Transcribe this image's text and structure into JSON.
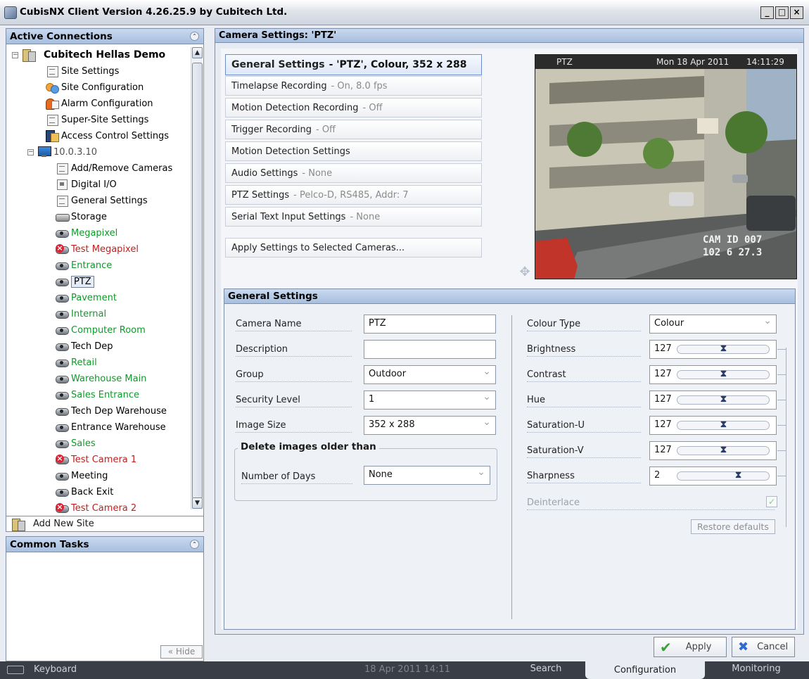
{
  "window": {
    "title": "CubisNX Client Version 4.26.25.9 by Cubitech Ltd.",
    "min": "_",
    "max": "□",
    "close": "×"
  },
  "left": {
    "active_connections": "Active Connections",
    "common_tasks": "Common Tasks",
    "add_new_site": "Add New Site",
    "hide": "« Hide",
    "tree": [
      {
        "label": "Cubitech Hellas Demo",
        "icon": "site-icon",
        "color": "#000000"
      },
      {
        "label": "Site Settings",
        "icon": "document-icon",
        "color": "#000000"
      },
      {
        "label": "Site Configuration",
        "icon": "gear-icon",
        "color": "#000000"
      },
      {
        "label": "Alarm Configuration",
        "icon": "alarm-icon",
        "color": "#000000"
      },
      {
        "label": "Super-Site Settings",
        "icon": "document-icon",
        "color": "#000000"
      },
      {
        "label": "Access Control Settings",
        "icon": "access-icon",
        "color": "#000000"
      },
      {
        "label": "10.0.3.10",
        "icon": "server-icon",
        "color": "#505050"
      },
      {
        "label": "Add/Remove Cameras",
        "icon": "document-icon",
        "color": "#000000"
      },
      {
        "label": "Digital I/O",
        "icon": "dio-icon",
        "color": "#000000"
      },
      {
        "label": "General Settings",
        "icon": "document-icon",
        "color": "#000000"
      },
      {
        "label": "Storage",
        "icon": "storage-icon",
        "color": "#000000"
      },
      {
        "label": "Megapixel",
        "icon": "camera-icon",
        "color": "#10992a"
      },
      {
        "label": "Test Megapixel",
        "icon": "camera-error-icon",
        "color": "#c0201e"
      },
      {
        "label": "Entrance",
        "icon": "camera-icon",
        "color": "#10992a"
      },
      {
        "label": "PTZ",
        "icon": "camera-icon",
        "color": "#000000"
      },
      {
        "label": "Pavement",
        "icon": "camera-icon",
        "color": "#10992a"
      },
      {
        "label": "Internal",
        "icon": "camera-icon",
        "color": "#10992a"
      },
      {
        "label": "Computer Room",
        "icon": "camera-icon",
        "color": "#10992a"
      },
      {
        "label": "Tech Dep",
        "icon": "camera-icon",
        "color": "#000000"
      },
      {
        "label": "Retail",
        "icon": "camera-icon",
        "color": "#10992a"
      },
      {
        "label": "Warehouse Main",
        "icon": "camera-icon",
        "color": "#10992a"
      },
      {
        "label": "Sales Entrance",
        "icon": "camera-icon",
        "color": "#10992a"
      },
      {
        "label": "Tech Dep Warehouse",
        "icon": "camera-icon",
        "color": "#000000"
      },
      {
        "label": "Entrance Warehouse",
        "icon": "camera-icon",
        "color": "#000000"
      },
      {
        "label": "Sales",
        "icon": "camera-icon",
        "color": "#10992a"
      },
      {
        "label": "Test Camera 1",
        "icon": "camera-error-icon",
        "color": "#c0201e"
      },
      {
        "label": "Meeting",
        "icon": "camera-icon",
        "color": "#000000"
      },
      {
        "label": "Back Exit",
        "icon": "camera-icon",
        "color": "#000000"
      },
      {
        "label": "Test Camera 2",
        "icon": "camera-error-icon",
        "color": "#c0201e"
      }
    ]
  },
  "main": {
    "header": "Camera Settings: 'PTZ'",
    "nav": [
      {
        "label": "General Settings",
        "sub": "- 'PTZ', Colour, 352 x 288"
      },
      {
        "label": "Timelapse Recording",
        "sub": "- On, 8.0 fps"
      },
      {
        "label": "Motion Detection Recording",
        "sub": "- Off"
      },
      {
        "label": "Trigger Recording",
        "sub": "- Off"
      },
      {
        "label": "Motion Detection Settings",
        "sub": ""
      },
      {
        "label": "Audio Settings",
        "sub": "- None"
      },
      {
        "label": "PTZ Settings",
        "sub": "- Pelco-D, RS485, Addr: 7"
      },
      {
        "label": "Serial Text Input Settings",
        "sub": "- None"
      },
      {
        "label": "Apply Settings to Selected Cameras...",
        "sub": ""
      }
    ],
    "video": {
      "camera": "PTZ",
      "date": "Mon 18 Apr 2011",
      "time": "14:11:29",
      "overlay1": "CAM ID 007",
      "overlay2": "102 6 27.3"
    }
  },
  "general": {
    "header": "General Settings",
    "camera_name_label": "Camera Name",
    "camera_name": "PTZ",
    "description_label": "Description",
    "description": "",
    "group_label": "Group",
    "group": "Outdoor",
    "security_label": "Security Level",
    "security": "1",
    "image_size_label": "Image Size",
    "image_size": "352 x 288",
    "delete_group": "Delete images older than",
    "days_label": "Number of Days",
    "days": "None",
    "colour_type_label": "Colour Type",
    "colour_type": "Colour",
    "sliders": [
      {
        "label": "Brightness",
        "value": "127",
        "level": 0.5
      },
      {
        "label": "Contrast",
        "value": "127",
        "level": 0.5
      },
      {
        "label": "Hue",
        "value": "127",
        "level": 0.5
      },
      {
        "label": "Saturation-U",
        "value": "127",
        "level": 0.5
      },
      {
        "label": "Saturation-V",
        "value": "127",
        "level": 0.5
      },
      {
        "label": "Sharpness",
        "value": "2",
        "level": 0.66
      }
    ],
    "deinterlace_label": "Deinterlace",
    "restore": "Restore defaults"
  },
  "buttons": {
    "apply": "Apply",
    "cancel": "Cancel"
  },
  "status": {
    "keyboard": "Keyboard",
    "datetime": "18 Apr 2011  14:11",
    "tab_search": "Search",
    "tab_config": "Configuration",
    "tab_monitoring": "Monitoring"
  }
}
